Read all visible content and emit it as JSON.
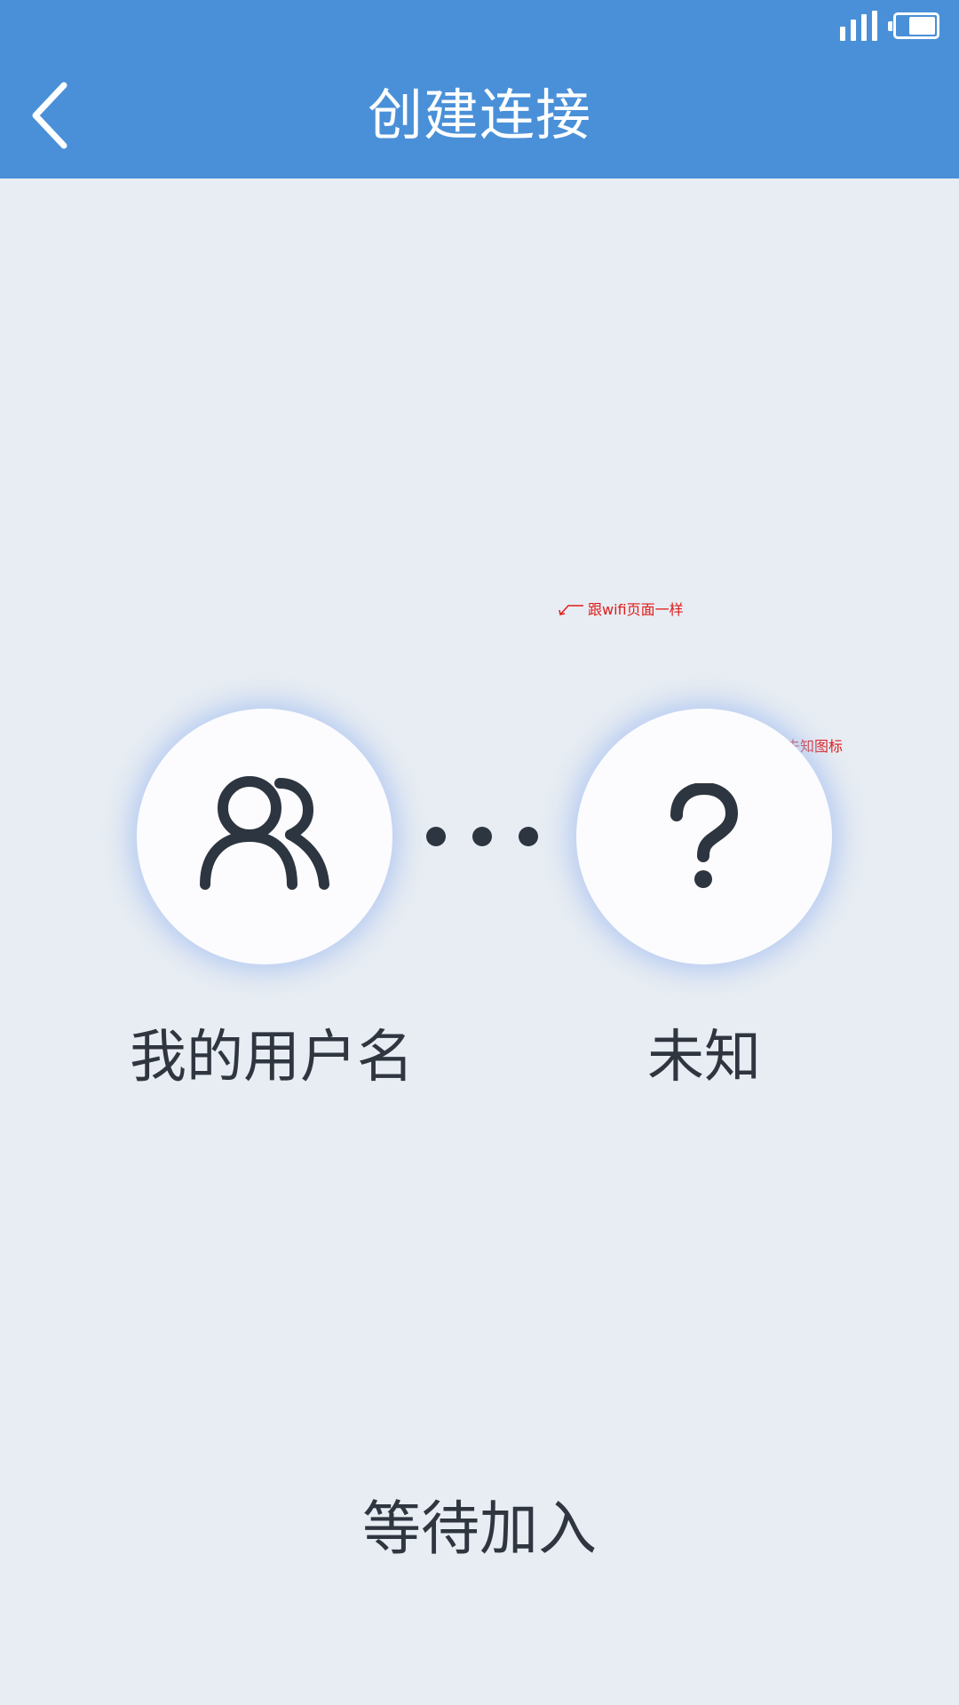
{
  "header": {
    "title": "创建连接",
    "background_color": "#4a90d8",
    "back_icon": "chevron-left-icon"
  },
  "status_bar": {
    "signal_icon": "signal-bars-icon",
    "battery_icon": "battery-icon",
    "battery_level": 0.7
  },
  "connection": {
    "self": {
      "icon": "users-icon",
      "label": "我的用户名"
    },
    "separator_icon": "ellipsis-dots-icon",
    "peer": {
      "icon": "question-mark-icon",
      "label": "未知"
    }
  },
  "status": {
    "text": "等待加入"
  },
  "annotations": {
    "note_1": "跟wifi页面一样",
    "note_2": "未知图标",
    "color": "#e01b1b"
  }
}
